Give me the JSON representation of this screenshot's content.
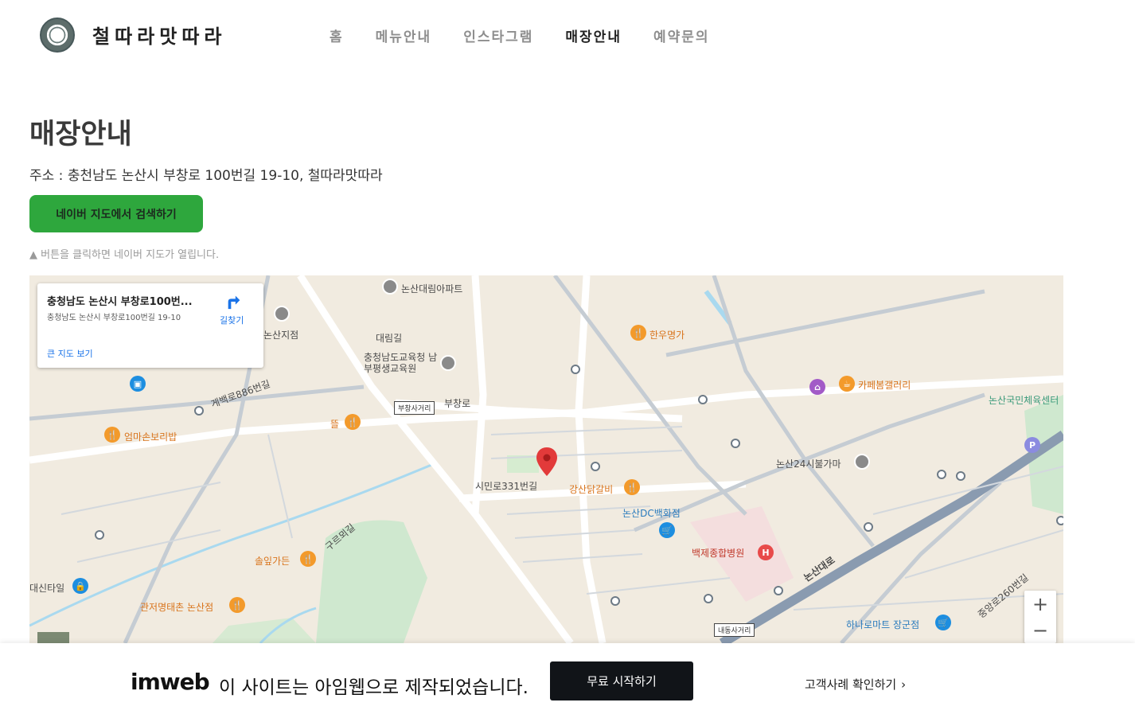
{
  "header": {
    "brand": "철따라맛따라",
    "nav": [
      {
        "label": "홈",
        "active": false
      },
      {
        "label": "메뉴안내",
        "active": false
      },
      {
        "label": "인스타그램",
        "active": false
      },
      {
        "label": "매장안내",
        "active": true
      },
      {
        "label": "예약문의",
        "active": false
      }
    ]
  },
  "main": {
    "title": "매장안내",
    "address": "주소 : 충천남도 논산시 부창로 100번길 19-10, 철따라맛따라",
    "naver_button": "네이버 지도에서 검색하기",
    "hint": "▲ 버튼을 클릭하면 네이버 지도가 열립니다."
  },
  "map": {
    "info_title": "충청남도 논산시 부창로100번...",
    "info_sub": "충청남도 논산시 부창로100번길 19-10",
    "info_link": "큰 지도 보기",
    "directions": "길찾기",
    "labels": {
      "l1": "논산대림아파트",
      "l2": "논산지점",
      "l3": "대림길",
      "l4": "충청남도교육청 남부평생교육원",
      "l5": "한우명가",
      "l6": "카페봄갤러리",
      "l7": "논산국민체육센터",
      "l8": "엄마손보리밥",
      "l9": "뜰",
      "l10": "부창로",
      "l11": "시민로331번길",
      "l12": "강산닭갈비",
      "l13": "논산DC백화점",
      "l14": "백제종합병원",
      "l15": "논산24시불가마",
      "l16": "솔잎가든",
      "l17": "관저명태촌 논산점",
      "l18": "대신타일",
      "l19": "하나로마트 장군점",
      "l20": "논산대로",
      "l21": "구르뫼길",
      "l22": "부창사거리",
      "l23": "내동사거리",
      "l24": "중앙로260번길",
      "l25": "게백로886번길"
    },
    "zoom_in": "+",
    "zoom_out": "−"
  },
  "footer": {
    "logo": "imweb",
    "text": "이 사이트는 아임웹으로 제작되었습니다.",
    "start_button": "무료 시작하기",
    "case_link": "고객사례 확인하기",
    "chevron": "›"
  }
}
